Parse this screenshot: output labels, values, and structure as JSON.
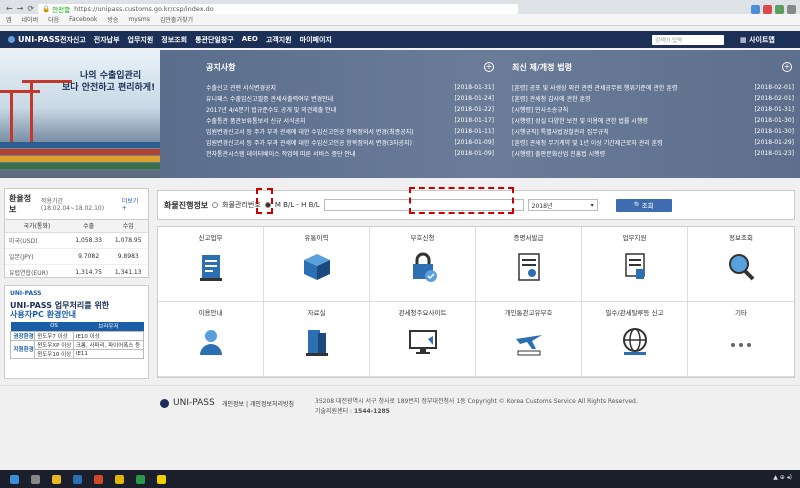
{
  "browser": {
    "security_label": "안전함",
    "url": "https://unipass.customs.go.kr/csp/index.do",
    "bookmarks": [
      "앱",
      "네이버",
      "다음",
      "Facebook",
      "방송",
      "mysms",
      "김만출거찾기"
    ]
  },
  "nav": {
    "logo": "UNI-PASS",
    "menu": [
      "전자신고",
      "전자납부",
      "업무지원",
      "정보조회",
      "통관단일창구",
      "AEO",
      "고객지원",
      "마이페이지"
    ],
    "search_placeholder": "검색어 입력",
    "sitemap": "사이트맵"
  },
  "banner": {
    "line1": "나의 수출입관리",
    "line2": "보다 안전하고 편리하게!"
  },
  "notices": {
    "title": "공지사항",
    "items": [
      {
        "text": "수출신고 관련 서식변경공지",
        "date": "[2018-01-31]"
      },
      {
        "text": "유니패스 수출입신고필증 관세사출력여부 변경안내",
        "date": "[2018-01-24]"
      },
      {
        "text": "2017년 4/4분기 법규준수도 공개 및 의견제출 안내",
        "date": "[2018-01-22]"
      },
      {
        "text": "수출통관 품관보류통보서 신규 서식공지",
        "date": "[2018-01-17]"
      },
      {
        "text": "임원변경신고서 등 주가 부과 관세에 대한 수입신고인공 항목정의서 변경(최종공지)",
        "date": "[2018-01-11]"
      },
      {
        "text": "임원변경신고서 등 주가 부과 관세에 대한 수입신고인공 항목정의서 변경(3차공지)",
        "date": "[2018-01-09]"
      },
      {
        "text": "전자통관시스템 데이터베이스 작업에 따른 서비스 중단 안내",
        "date": "[2018-01-09]"
      }
    ]
  },
  "laws": {
    "title": "최신 제/개정 법령",
    "items": [
      {
        "text": "[훈령] 공포 및 사생상 외관 관련 관세공무원 행위기준에 관한 훈령",
        "date": "[2018-02-01]"
      },
      {
        "text": "[훈령] 관세청 감사에 관한 훈령",
        "date": "[2018-02-01]"
      },
      {
        "text": "[시행령] 민사소송규칙",
        "date": "[2018-01-31]"
      },
      {
        "text": "[시행령] 성실 다양한 보전 및 이용에 관한 법률 시행령",
        "date": "[2018-01-30]"
      },
      {
        "text": "[시행규칙] 특별사법경찰관리 집무규칙",
        "date": "[2018-01-30]"
      },
      {
        "text": "[훈령] 관세청 무기계약 및 1년 이상 기간제근로자 관리 훈령",
        "date": "[2018-01-29]"
      },
      {
        "text": "[시행령] 출판문화산업 진흥법 시행령",
        "date": "[2018-01-23]"
      }
    ]
  },
  "rates": {
    "title": "환율정보",
    "period": "적용기간(18.02.04~18.02.10)",
    "more": "더보기 +",
    "headers": [
      "국가(통화)",
      "수출",
      "수입"
    ],
    "rows": [
      {
        "country": "미국(USD)",
        "export": "1,058.33",
        "import": "1,078.95"
      },
      {
        "country": "일본(JPY)",
        "export": "9.7082",
        "import": "9.8983"
      },
      {
        "country": "유럽연합(EUR)",
        "export": "1,314.75",
        "import": "1,341.13"
      }
    ]
  },
  "pc_guide": {
    "logo": "UNI-PASS",
    "title_line1": "UNI-PASS 업무처리를 위한",
    "title_line2": "사용자PC 환경안내",
    "headers": [
      "OS",
      "브라우저"
    ],
    "rows": [
      {
        "group": "권장환경",
        "os": "윈도우7 이상",
        "browser": "IE10 이상"
      },
      {
        "group": "지원환경",
        "os": "윈도우XP 이상",
        "browser": "크롬, 사파리, 파이어폭스 등"
      },
      {
        "group": "",
        "os": "윈도우10 이상",
        "browser": "IE11"
      }
    ]
  },
  "tracking": {
    "title": "화물진행정보",
    "radio1": "화물관리번호",
    "radio2": "M B/L - H B/L",
    "year": "2018년",
    "button": "조회"
  },
  "services": [
    {
      "label": "신고업무",
      "icon": "document-check-icon"
    },
    {
      "label": "유통이력",
      "icon": "boxes-icon"
    },
    {
      "label": "부호신청",
      "icon": "lock-icon"
    },
    {
      "label": "증명서발급",
      "icon": "certificate-icon"
    },
    {
      "label": "업무지원",
      "icon": "stamp-icon"
    },
    {
      "label": "정보조회",
      "icon": "magnifier-icon"
    },
    {
      "label": "이용안내",
      "icon": "person-icon"
    },
    {
      "label": "자료실",
      "icon": "books-icon"
    },
    {
      "label": "관세청주요사이트",
      "icon": "monitor-icon"
    },
    {
      "label": "개인통관고유부호",
      "icon": "plane-icon"
    },
    {
      "label": "밀수/관세탈루등 신고",
      "icon": "globe-icon"
    },
    {
      "label": "기타",
      "icon": "more-icon"
    }
  ],
  "footer": {
    "logo": "UNI-PASS",
    "links": "개인정보 | 개인정보처리방침",
    "address": "35208 대전광역시 서구 청사로 189번지 정부대전청사 1동    Copyright © Korea Customs Service All Rights Reserved.",
    "phone_label": "기술지원센터 : ",
    "phone": "1544-1285"
  },
  "colors": {
    "nav": "#1b2f57",
    "news_bg": "#627590",
    "accent": "#3f6bb0",
    "highlight": "#cc0000"
  }
}
